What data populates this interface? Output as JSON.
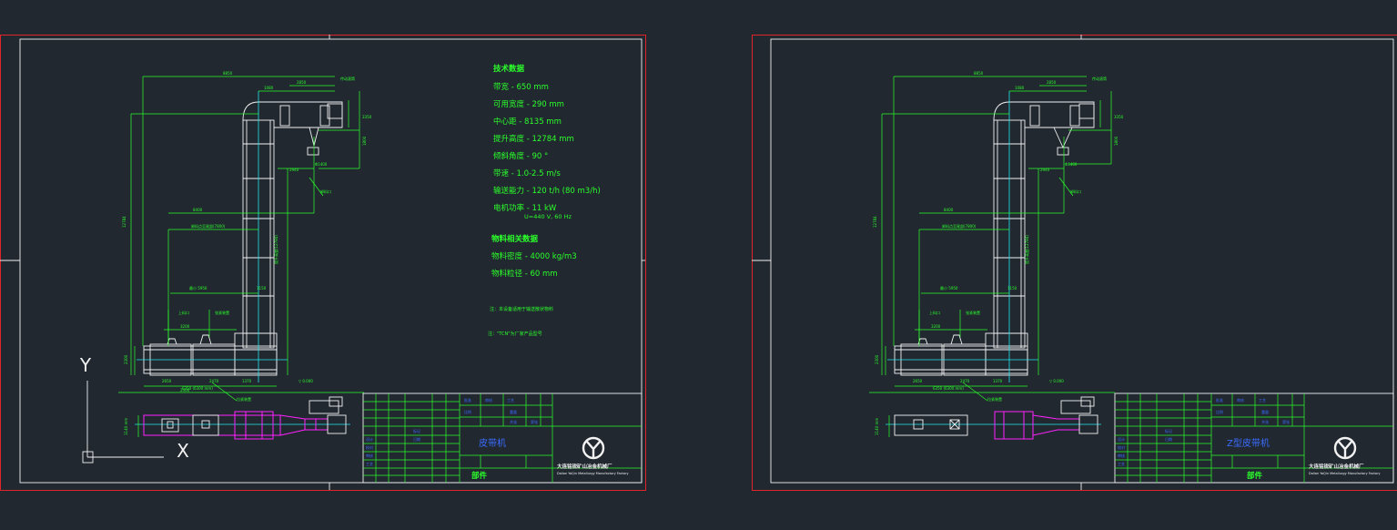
{
  "sheets": [
    {
      "title": "皮带机",
      "title_color": "#3a6cff",
      "subtitle": "部件",
      "company": "大连铭锐矿山冶金机械厂",
      "company_en": "Dalian YaQin Metallurgy Manufactory Factory"
    },
    {
      "title": "Z型皮带机",
      "title_color": "#3a6cff",
      "subtitle": "部件",
      "company": "大连铭锐矿山冶金机械厂",
      "company_en": "Dalian YaQin Metallurgy Manufactory Factory"
    }
  ],
  "tech": {
    "heading": "技术数据",
    "lines": [
      "带宽 - 650 mm",
      "可用宽度 - 290 mm",
      "中心距 - 8135 mm",
      "提升高度 - 12784 mm",
      "倾斜角度 - 90 °",
      "带速 - 1.0-2.5 m/s",
      "输送能力 - 120 t/h (80 m3/h)",
      "电机功率 - 11 kW",
      "U=440 V, 60 Hz"
    ],
    "material_heading": "物料相关数据",
    "material_lines": [
      "物料密度 - 4000 kg/m3",
      "物料粒径 - 60 mm"
    ],
    "note1": "注：本设备适用于输送散状物料",
    "note2": "注：\"TCN\"为厂家产品型号"
  },
  "ucs": {
    "x_label": "X",
    "y_label": "Y"
  },
  "colors": {
    "background": "#212830",
    "sheet_border": "#e0242a",
    "drawing_line": "#f2f2f2",
    "dimension": "#2bff2b",
    "plan_view": "#ff22ff",
    "centerline": "#22e8f0",
    "text_blue": "#3a6cff"
  }
}
